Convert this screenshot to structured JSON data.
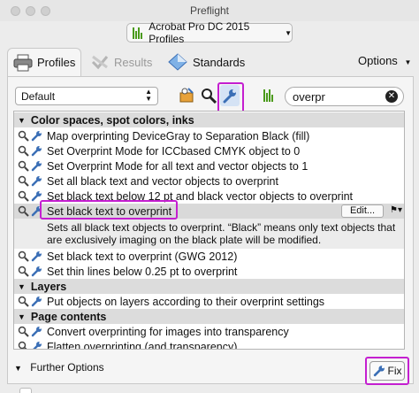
{
  "window": {
    "title": "Preflight"
  },
  "profile_selector": {
    "value": "Acrobat Pro DC 2015 Profiles"
  },
  "tabs": [
    {
      "label": "Profiles",
      "active": true
    },
    {
      "label": "Results",
      "active": false
    },
    {
      "label": "Standards",
      "active": false
    }
  ],
  "options_label": "Options",
  "library_select": {
    "value": "Default"
  },
  "search": {
    "value": "overpr"
  },
  "groups": [
    {
      "label": "Color spaces, spot colors, inks"
    },
    {
      "label": "Layers"
    },
    {
      "label": "Page contents"
    }
  ],
  "items": [
    "Map overprinting DeviceGray to Separation Black (fill)",
    "Set Overprint Mode for ICCbased CMYK object to 0",
    "Set Overprint Mode for all text and vector objects to 1",
    "Set all black text and vector objects to overprint",
    "Set black text below 12 pt and black vector objects to overprint",
    "Set black text to overprint",
    "Set black text to overprint (GWG 2012)",
    "Set thin lines below 0.25 pt to overprint",
    "Put objects on layers according to their overprint settings",
    "Convert overprinting for images into transparency",
    "Flatten overprinting (and transparency)"
  ],
  "selected_item": {
    "edit_label": "Edit...",
    "description": [
      "Sets all black text objects to overprint. “Black” means only text objects that",
      "are exclusively imaging on the black plate will be modified."
    ]
  },
  "further_options_label": "Further Options",
  "fix_button_label": "Fix",
  "colors": {
    "highlight": "#c41fd0",
    "accent_green": "#4a9a1a",
    "wrench_blue": "#3b6fb6"
  },
  "icons": [
    "printer-icon",
    "results-icon",
    "standards-icon",
    "wrench-icon",
    "magnifier-icon",
    "clear-icon"
  ]
}
